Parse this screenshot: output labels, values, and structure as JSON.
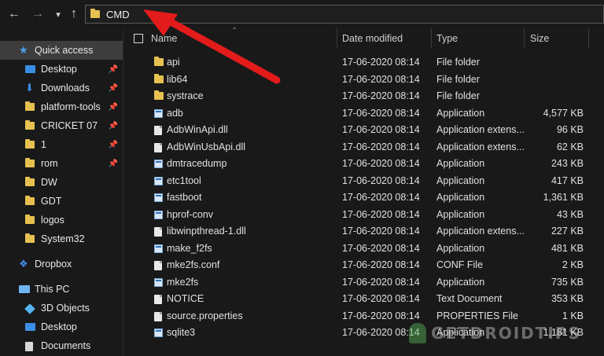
{
  "address_bar": {
    "path": "CMD"
  },
  "columns": {
    "name": "Name",
    "date": "Date modified",
    "type": "Type",
    "size": "Size"
  },
  "sidebar": {
    "items": [
      {
        "label": "Quick access",
        "icon": "star-icon",
        "pinned": false
      },
      {
        "label": "Desktop",
        "icon": "desktop-icon",
        "pinned": true
      },
      {
        "label": "Downloads",
        "icon": "download-icon",
        "pinned": true
      },
      {
        "label": "platform-tools",
        "icon": "folder-icon",
        "pinned": true
      },
      {
        "label": "CRICKET 07",
        "icon": "folder-icon",
        "pinned": true
      },
      {
        "label": "1",
        "icon": "folder-icon",
        "pinned": true
      },
      {
        "label": "rom",
        "icon": "folder-icon",
        "pinned": true
      },
      {
        "label": "DW",
        "icon": "folder-icon",
        "pinned": false
      },
      {
        "label": "GDT",
        "icon": "folder-icon",
        "pinned": false
      },
      {
        "label": "logos",
        "icon": "folder-icon",
        "pinned": false
      },
      {
        "label": "System32",
        "icon": "folder-icon",
        "pinned": false
      },
      {
        "label": "Dropbox",
        "icon": "dropbox-icon",
        "pinned": false
      },
      {
        "label": "This PC",
        "icon": "pc-icon",
        "pinned": false
      },
      {
        "label": "3D Objects",
        "icon": "3d-objects-icon",
        "pinned": false
      },
      {
        "label": "Desktop",
        "icon": "desktop-icon",
        "pinned": false
      },
      {
        "label": "Documents",
        "icon": "document-icon",
        "pinned": false
      }
    ]
  },
  "files": [
    {
      "name": "api",
      "date": "17-06-2020 08:14",
      "type": "File folder",
      "size": "",
      "icon": "folder-icon"
    },
    {
      "name": "lib64",
      "date": "17-06-2020 08:14",
      "type": "File folder",
      "size": "",
      "icon": "folder-icon"
    },
    {
      "name": "systrace",
      "date": "17-06-2020 08:14",
      "type": "File folder",
      "size": "",
      "icon": "folder-icon"
    },
    {
      "name": "adb",
      "date": "17-06-2020 08:14",
      "type": "Application",
      "size": "4,577 KB",
      "icon": "application-icon"
    },
    {
      "name": "AdbWinApi.dll",
      "date": "17-06-2020 08:14",
      "type": "Application extens...",
      "size": "96 KB",
      "icon": "file-icon"
    },
    {
      "name": "AdbWinUsbApi.dll",
      "date": "17-06-2020 08:14",
      "type": "Application extens...",
      "size": "62 KB",
      "icon": "file-icon"
    },
    {
      "name": "dmtracedump",
      "date": "17-06-2020 08:14",
      "type": "Application",
      "size": "243 KB",
      "icon": "application-icon"
    },
    {
      "name": "etc1tool",
      "date": "17-06-2020 08:14",
      "type": "Application",
      "size": "417 KB",
      "icon": "application-icon"
    },
    {
      "name": "fastboot",
      "date": "17-06-2020 08:14",
      "type": "Application",
      "size": "1,361 KB",
      "icon": "application-icon"
    },
    {
      "name": "hprof-conv",
      "date": "17-06-2020 08:14",
      "type": "Application",
      "size": "43 KB",
      "icon": "application-icon"
    },
    {
      "name": "libwinpthread-1.dll",
      "date": "17-06-2020 08:14",
      "type": "Application extens...",
      "size": "227 KB",
      "icon": "file-icon"
    },
    {
      "name": "make_f2fs",
      "date": "17-06-2020 08:14",
      "type": "Application",
      "size": "481 KB",
      "icon": "application-icon"
    },
    {
      "name": "mke2fs.conf",
      "date": "17-06-2020 08:14",
      "type": "CONF File",
      "size": "2 KB",
      "icon": "file-icon"
    },
    {
      "name": "mke2fs",
      "date": "17-06-2020 08:14",
      "type": "Application",
      "size": "735 KB",
      "icon": "application-icon"
    },
    {
      "name": "NOTICE",
      "date": "17-06-2020 08:14",
      "type": "Text Document",
      "size": "353 KB",
      "icon": "file-icon"
    },
    {
      "name": "source.properties",
      "date": "17-06-2020 08:14",
      "type": "PROPERTIES File",
      "size": "1 KB",
      "icon": "file-icon"
    },
    {
      "name": "sqlite3",
      "date": "17-06-2020 08:14",
      "type": "Application",
      "size": "1,181 KB",
      "icon": "application-icon"
    }
  ],
  "watermark": {
    "text": "GETDROIDTIPS"
  },
  "colors": {
    "background": "#191919",
    "folder": "#e6c14f",
    "accent": "#3a8ee6",
    "annotation_arrow": "#e31b1b"
  }
}
